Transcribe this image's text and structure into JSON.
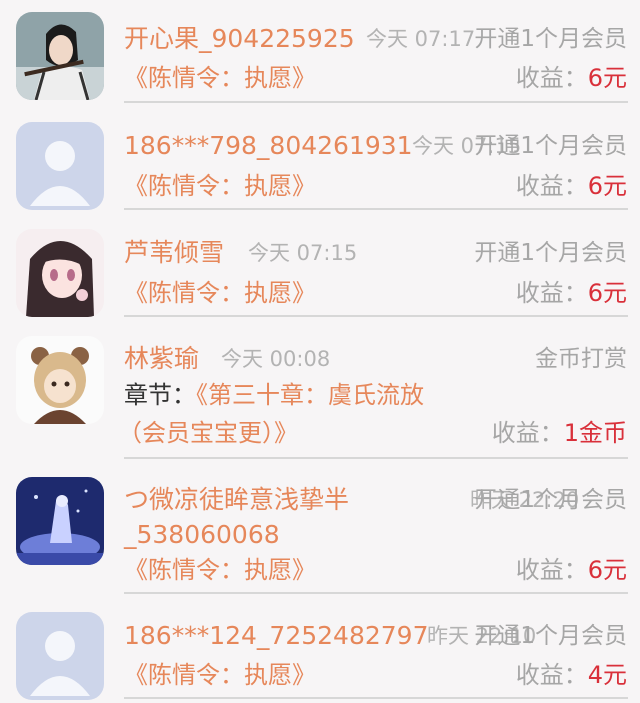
{
  "records": [
    {
      "avatar": "anime-man-avatar",
      "name": "开心果_904225925",
      "time": "今天 07:17",
      "action": "开通1个月会员",
      "book": "《陈情令：执愿》",
      "income_label": "收益：",
      "income_value": "6元"
    },
    {
      "avatar": "default-user-avatar",
      "name": "186***798_804261931",
      "time": "今天 07:15",
      "action": "开通1个月会员",
      "book": "《陈情令：执愿》",
      "income_label": "收益：",
      "income_value": "6元"
    },
    {
      "avatar": "anime-girl-avatar",
      "name": "芦苇倾雪",
      "time": "今天 07:15",
      "action": "开通1个月会员",
      "book": "《陈情令：执愿》",
      "income_label": "收益：",
      "income_value": "6元"
    },
    {
      "avatar": "bear-hood-avatar",
      "name": "林紫瑜",
      "time": "今天 00:08",
      "action": "金币打赏",
      "chapter_label": "章节：",
      "book_line1": "《第三十章：虞氏流放",
      "book_line2": "（会员宝宝更）》",
      "income_label": "收益：",
      "income_value": "1金币"
    },
    {
      "avatar": "blue-night-avatar",
      "name_line1": "つ微凉徒眸意浅挚半",
      "name_line2": "_538060068",
      "time": "昨天 22:20",
      "action": "开通1个月会员",
      "book": "《陈情令：执愿》",
      "income_label": "收益：",
      "income_value": "6元"
    },
    {
      "avatar": "default-user-avatar",
      "name": "186***124_7252482797",
      "time": "昨天 22:10",
      "action": "开通1个月会员",
      "book": "《陈情令：执愿》",
      "income_label": "收益：",
      "income_value": "4元"
    }
  ]
}
